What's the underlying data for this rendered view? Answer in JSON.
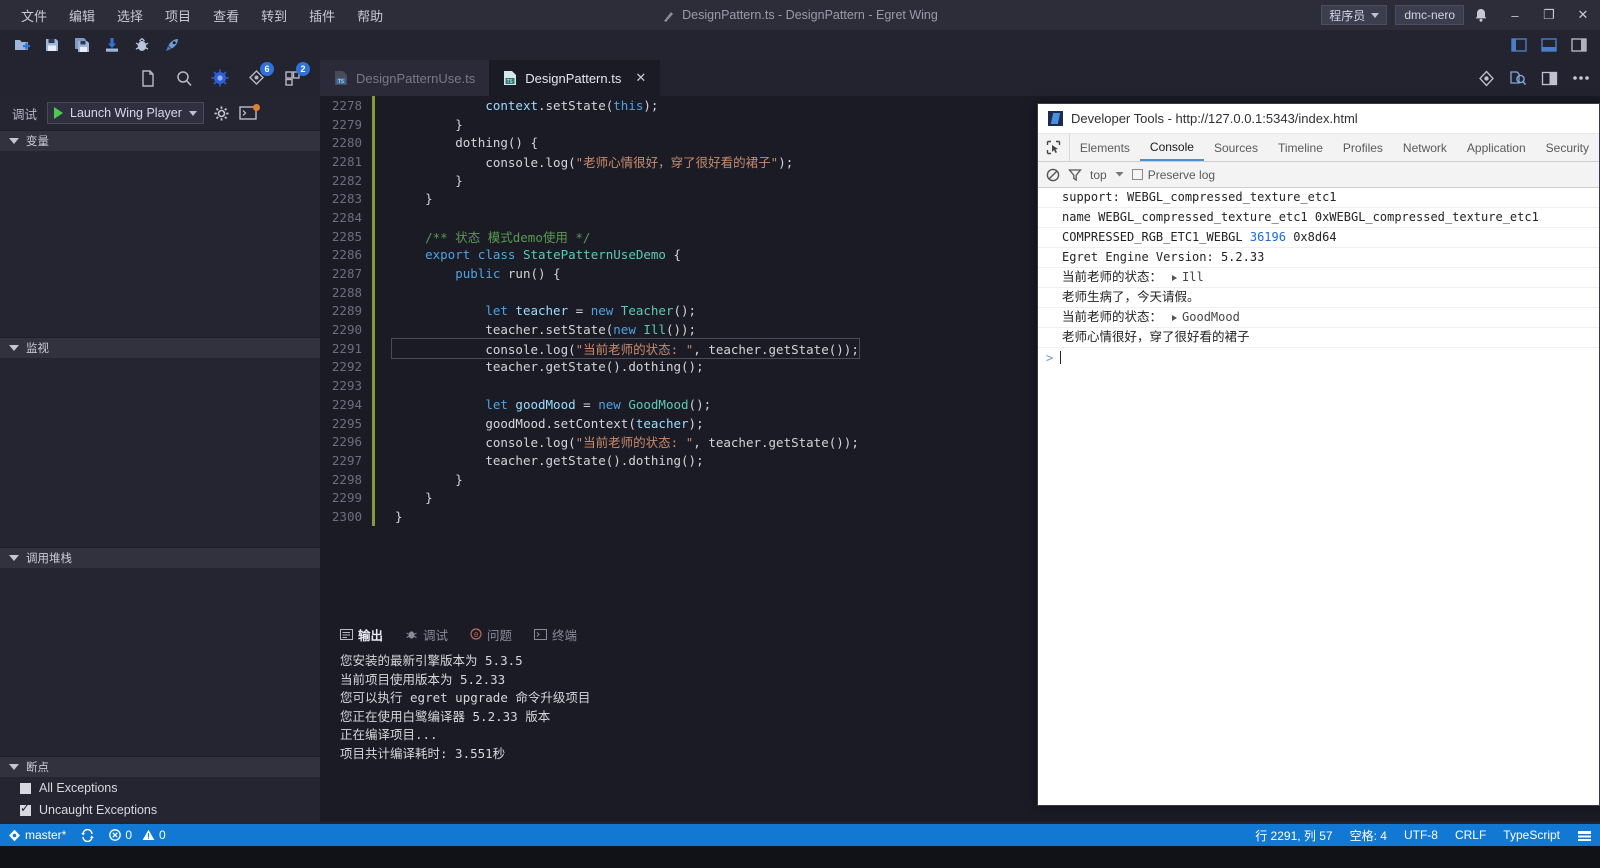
{
  "titlebar": {
    "menus": [
      "文件",
      "编辑",
      "选择",
      "项目",
      "查看",
      "转到",
      "插件",
      "帮助"
    ],
    "title": "DesignPattern.ts - DesignPattern - Egret Wing",
    "user_mode": "程序员",
    "user_name": "dmc-nero",
    "minimize": "–",
    "maximize": "❐",
    "close": "✕"
  },
  "toolbar": {
    "icons": [
      "new-file-icon",
      "save-icon",
      "save-all-icon",
      "import-icon",
      "bug-icon",
      "rocket-icon"
    ],
    "layout_icons": [
      "toggle-sidebar-icon",
      "toggle-panel-icon",
      "toggle-right-icon"
    ]
  },
  "activitybar": {
    "items": [
      {
        "name": "explorer-icon",
        "badge": ""
      },
      {
        "name": "search-icon",
        "badge": ""
      },
      {
        "name": "debug-icon",
        "badge": ""
      },
      {
        "name": "source-control-icon",
        "badge": "6"
      },
      {
        "name": "extensions-icon",
        "badge": "2"
      }
    ]
  },
  "sidebar": {
    "debug_label": "调试",
    "launch_config": "Launch Wing Player",
    "sections": [
      {
        "title": "变量",
        "items": []
      },
      {
        "title": "监视",
        "items": []
      },
      {
        "title": "调用堆栈",
        "items": []
      },
      {
        "title": "断点",
        "items": []
      }
    ],
    "breakpoints": [
      {
        "label": "All Exceptions",
        "checked": false
      },
      {
        "label": "Uncaught Exceptions",
        "checked": true
      }
    ]
  },
  "editor": {
    "tabs": [
      {
        "label": "DesignPatternUse.ts",
        "active": false,
        "closable": false
      },
      {
        "label": "DesignPattern.ts",
        "active": true,
        "closable": true
      }
    ],
    "tab_close_glyph": "✕",
    "actions": [
      "source-control-icon",
      "find-references-icon",
      "split-editor-icon",
      "more-actions-icon"
    ],
    "first_line_number": 2278,
    "current_line": 2291,
    "lines": [
      {
        "n": 2278,
        "tokens": [
          {
            "t": "            ",
            "c": "pl"
          },
          {
            "t": "context",
            "c": "id"
          },
          {
            "t": ".",
            "c": "pl"
          },
          {
            "t": "setState",
            "c": "pl"
          },
          {
            "t": "(",
            "c": "pl"
          },
          {
            "t": "this",
            "c": "kw"
          },
          {
            "t": ");",
            "c": "pl"
          }
        ]
      },
      {
        "n": 2279,
        "tokens": [
          {
            "t": "        }",
            "c": "pl"
          }
        ]
      },
      {
        "n": 2280,
        "tokens": [
          {
            "t": "        ",
            "c": "pl"
          },
          {
            "t": "dothing",
            "c": "pl"
          },
          {
            "t": "() {",
            "c": "pl"
          }
        ]
      },
      {
        "n": 2281,
        "tokens": [
          {
            "t": "            ",
            "c": "pl"
          },
          {
            "t": "console",
            "c": "pl"
          },
          {
            "t": ".",
            "c": "pl"
          },
          {
            "t": "log",
            "c": "pl"
          },
          {
            "t": "(",
            "c": "pl"
          },
          {
            "t": "\"老师心情很好，穿了很好看的裙子\"",
            "c": "str"
          },
          {
            "t": ");",
            "c": "pl"
          }
        ]
      },
      {
        "n": 2282,
        "tokens": [
          {
            "t": "        }",
            "c": "pl"
          }
        ]
      },
      {
        "n": 2283,
        "tokens": [
          {
            "t": "    }",
            "c": "pl"
          }
        ]
      },
      {
        "n": 2284,
        "tokens": []
      },
      {
        "n": 2285,
        "tokens": [
          {
            "t": "    ",
            "c": "pl"
          },
          {
            "t": "/** 状态 模式demo使用 */",
            "c": "cmt"
          }
        ]
      },
      {
        "n": 2286,
        "tokens": [
          {
            "t": "    ",
            "c": "pl"
          },
          {
            "t": "export",
            "c": "kw"
          },
          {
            "t": " ",
            "c": "pl"
          },
          {
            "t": "class",
            "c": "kw"
          },
          {
            "t": " ",
            "c": "pl"
          },
          {
            "t": "StatePatternUseDemo",
            "c": "typ"
          },
          {
            "t": " {",
            "c": "pl"
          }
        ]
      },
      {
        "n": 2287,
        "tokens": [
          {
            "t": "        ",
            "c": "pl"
          },
          {
            "t": "public",
            "c": "kw"
          },
          {
            "t": " ",
            "c": "pl"
          },
          {
            "t": "run",
            "c": "pl"
          },
          {
            "t": "() {",
            "c": "pl"
          }
        ]
      },
      {
        "n": 2288,
        "tokens": []
      },
      {
        "n": 2289,
        "tokens": [
          {
            "t": "            ",
            "c": "pl"
          },
          {
            "t": "let",
            "c": "kw"
          },
          {
            "t": " ",
            "c": "pl"
          },
          {
            "t": "teacher",
            "c": "id"
          },
          {
            "t": " = ",
            "c": "pl"
          },
          {
            "t": "new",
            "c": "kw"
          },
          {
            "t": " ",
            "c": "pl"
          },
          {
            "t": "Teacher",
            "c": "typ"
          },
          {
            "t": "();",
            "c": "pl"
          }
        ]
      },
      {
        "n": 2290,
        "tokens": [
          {
            "t": "            ",
            "c": "pl"
          },
          {
            "t": "teacher",
            "c": "pl"
          },
          {
            "t": ".",
            "c": "pl"
          },
          {
            "t": "setState",
            "c": "pl"
          },
          {
            "t": "(",
            "c": "pl"
          },
          {
            "t": "new",
            "c": "kw"
          },
          {
            "t": " ",
            "c": "pl"
          },
          {
            "t": "Ill",
            "c": "typ"
          },
          {
            "t": "());",
            "c": "pl"
          }
        ]
      },
      {
        "n": 2291,
        "tokens": [
          {
            "t": "            ",
            "c": "pl"
          },
          {
            "t": "console",
            "c": "pl"
          },
          {
            "t": ".",
            "c": "pl"
          },
          {
            "t": "log",
            "c": "pl"
          },
          {
            "t": "(",
            "c": "pl"
          },
          {
            "t": "\"当前老师的状态: \"",
            "c": "str"
          },
          {
            "t": ", ",
            "c": "pl"
          },
          {
            "t": "teacher",
            "c": "pl"
          },
          {
            "t": ".",
            "c": "pl"
          },
          {
            "t": "getState",
            "c": "pl"
          },
          {
            "t": "());",
            "c": "pl"
          }
        ]
      },
      {
        "n": 2292,
        "tokens": [
          {
            "t": "            ",
            "c": "pl"
          },
          {
            "t": "teacher",
            "c": "pl"
          },
          {
            "t": ".",
            "c": "pl"
          },
          {
            "t": "getState",
            "c": "pl"
          },
          {
            "t": "().",
            "c": "pl"
          },
          {
            "t": "dothing",
            "c": "pl"
          },
          {
            "t": "();",
            "c": "pl"
          }
        ]
      },
      {
        "n": 2293,
        "tokens": []
      },
      {
        "n": 2294,
        "tokens": [
          {
            "t": "            ",
            "c": "pl"
          },
          {
            "t": "let",
            "c": "kw"
          },
          {
            "t": " ",
            "c": "pl"
          },
          {
            "t": "goodMood",
            "c": "id"
          },
          {
            "t": " = ",
            "c": "pl"
          },
          {
            "t": "new",
            "c": "kw"
          },
          {
            "t": " ",
            "c": "pl"
          },
          {
            "t": "GoodMood",
            "c": "typ"
          },
          {
            "t": "();",
            "c": "pl"
          }
        ]
      },
      {
        "n": 2295,
        "tokens": [
          {
            "t": "            ",
            "c": "pl"
          },
          {
            "t": "goodMood",
            "c": "pl"
          },
          {
            "t": ".",
            "c": "pl"
          },
          {
            "t": "setContext",
            "c": "pl"
          },
          {
            "t": "(",
            "c": "pl"
          },
          {
            "t": "teacher",
            "c": "id"
          },
          {
            "t": ");",
            "c": "pl"
          }
        ]
      },
      {
        "n": 2296,
        "tokens": [
          {
            "t": "            ",
            "c": "pl"
          },
          {
            "t": "console",
            "c": "pl"
          },
          {
            "t": ".",
            "c": "pl"
          },
          {
            "t": "log",
            "c": "pl"
          },
          {
            "t": "(",
            "c": "pl"
          },
          {
            "t": "\"当前老师的状态: \"",
            "c": "str"
          },
          {
            "t": ", ",
            "c": "pl"
          },
          {
            "t": "teacher",
            "c": "pl"
          },
          {
            "t": ".",
            "c": "pl"
          },
          {
            "t": "getState",
            "c": "pl"
          },
          {
            "t": "());",
            "c": "pl"
          }
        ]
      },
      {
        "n": 2297,
        "tokens": [
          {
            "t": "            ",
            "c": "pl"
          },
          {
            "t": "teacher",
            "c": "pl"
          },
          {
            "t": ".",
            "c": "pl"
          },
          {
            "t": "getState",
            "c": "pl"
          },
          {
            "t": "().",
            "c": "pl"
          },
          {
            "t": "dothing",
            "c": "pl"
          },
          {
            "t": "();",
            "c": "pl"
          }
        ]
      },
      {
        "n": 2298,
        "tokens": [
          {
            "t": "        }",
            "c": "pl"
          }
        ]
      },
      {
        "n": 2299,
        "tokens": [
          {
            "t": "    }",
            "c": "pl"
          }
        ]
      },
      {
        "n": 2300,
        "tokens": [
          {
            "t": "}",
            "c": "pl"
          }
        ]
      }
    ]
  },
  "output_panel": {
    "tabs": [
      {
        "label": "输出",
        "active": true,
        "badge": ""
      },
      {
        "label": "调试",
        "active": false,
        "badge": ""
      },
      {
        "label": "问题",
        "active": false,
        "badge": "0"
      },
      {
        "label": "终端",
        "active": false,
        "badge": ""
      }
    ],
    "lines": [
      "您安装的最新引擎版本为 5.3.5",
      "当前项目使用版本为 5.2.33",
      "您可以执行 egret upgrade 命令升级项目",
      "您正在使用白鹭编译器 5.2.33 版本",
      "正在编译项目...",
      "项目共计编译耗时: 3.551秒"
    ]
  },
  "devtools": {
    "window_title": "Developer Tools - http://127.0.0.1:5343/index.html",
    "tabs": [
      {
        "label": "Elements",
        "active": false
      },
      {
        "label": "Console",
        "active": true
      },
      {
        "label": "Sources",
        "active": false
      },
      {
        "label": "Timeline",
        "active": false
      },
      {
        "label": "Profiles",
        "active": false
      },
      {
        "label": "Network",
        "active": false
      },
      {
        "label": "Application",
        "active": false
      },
      {
        "label": "Security",
        "active": false
      }
    ],
    "toolbar": {
      "clear_icon": "clear-console-icon",
      "filter_icon": "filter-icon",
      "context": "top",
      "preserve_log_label": "Preserve log",
      "preserve_log_checked": false
    },
    "console_lines": [
      {
        "type": "mono",
        "text": "support: WEBGL_compressed_texture_etc1"
      },
      {
        "type": "mono",
        "text": "name WEBGL_compressed_texture_etc1 0xWEBGL_compressed_texture_etc1"
      },
      {
        "type": "mono-num",
        "pre": "COMPRESSED_RGB_ETC1_WEBGL ",
        "num": "36196",
        "post": " 0x8d64"
      },
      {
        "type": "mono",
        "text": "Egret Engine Version: 5.2.33"
      },
      {
        "type": "obj",
        "label": "当前老师的状态：",
        "object": "Ill"
      },
      {
        "type": "cn",
        "text": "老师生病了，今天请假。"
      },
      {
        "type": "obj",
        "label": "当前老师的状态：",
        "object": "GoodMood"
      },
      {
        "type": "cn",
        "text": "老师心情很好，穿了很好看的裙子"
      }
    ]
  },
  "statusbar": {
    "branch": "master*",
    "sync_icon": "sync-icon",
    "errors": "0",
    "warnings": "0",
    "cursor": "行 2291, 列 57",
    "spaces": "空格: 4",
    "encoding": "UTF-8",
    "eol": "CRLF",
    "language": "TypeScript",
    "feedback_icon": "feedback-icon"
  },
  "colors": {
    "accent": "#1178d4",
    "titlebar_bg": "#2d2d3a",
    "editor_bg": "#1b1b26",
    "sidebar_bg": "#252532",
    "badge": "#2f72d8"
  }
}
